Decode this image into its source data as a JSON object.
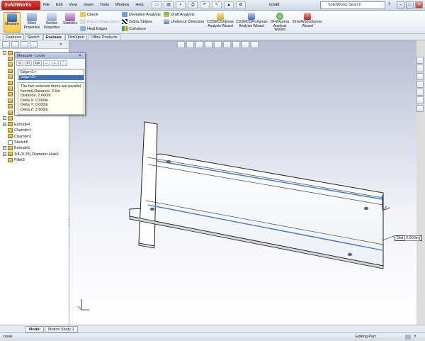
{
  "app": {
    "name": "SolidWorks",
    "doc_title": "cover",
    "search_placeholder": "SolidWorks Search"
  },
  "menu": [
    "File",
    "Edit",
    "View",
    "Insert",
    "Tools",
    "Window",
    "Help"
  ],
  "ribbon": {
    "big_buttons": [
      {
        "label1": "Measure",
        "label2": ""
      },
      {
        "label1": "Mass",
        "label2": "Properties"
      },
      {
        "label1": "Section",
        "label2": "Properties"
      },
      {
        "label1": "Statistics",
        "label2": ""
      }
    ],
    "col1": [
      {
        "label": "Check",
        "enabled": true
      },
      {
        "label": "Import Diagnostics",
        "enabled": false
      },
      {
        "label": "Heal Edges",
        "enabled": true
      }
    ],
    "col2": [
      {
        "label": "Deviation Analysis"
      },
      {
        "label": "Zebra Stripes"
      },
      {
        "label": "Curvature"
      }
    ],
    "col3": [
      {
        "label": "Draft Analysis"
      },
      {
        "label": "Undercut Detection"
      }
    ],
    "xpress": [
      {
        "label1": "COSMOSXpress",
        "label2": "Analysis Wizard"
      },
      {
        "label1": "COSMOSFloXpress",
        "label2": "Analysis Wizard"
      },
      {
        "label1": "DFMXpress",
        "label2": "Analysis",
        "label3": "Wizard"
      },
      {
        "label1": "DriveWorksXpress",
        "label2": "Wizard"
      }
    ]
  },
  "tabs": [
    "Features",
    "Sketch",
    "Evaluate",
    "DimXpert",
    "Office Products"
  ],
  "active_tab": "Evaluate",
  "measure_dialog": {
    "title": "Measure - cover",
    "tool_labels": [
      "in",
      "xyz"
    ],
    "selections": [
      "Edge<1>",
      "Edge<2>"
    ],
    "results": [
      "The two selected items are parallel.",
      "Normal Distance: 2.6in",
      "Distance: 2.600in",
      "Delta X: 0.000in",
      "Delta Y: 0.000in",
      "Delta Z: 2.600in"
    ]
  },
  "tree": [
    {
      "label": "cov",
      "expander": "-",
      "type": "root"
    },
    {
      "label": "",
      "expander": "",
      "type": "feat"
    },
    {
      "label": "",
      "expander": "",
      "type": "feat"
    },
    {
      "label": "",
      "expander": "",
      "type": "feat"
    },
    {
      "label": "",
      "expander": "",
      "type": "feat"
    },
    {
      "label": "",
      "expander": "",
      "type": "feat"
    },
    {
      "label": "",
      "expander": "",
      "type": "feat"
    },
    {
      "label": "",
      "expander": "",
      "type": "feat"
    },
    {
      "label": "",
      "expander": "",
      "type": "feat"
    },
    {
      "label": "",
      "expander": "",
      "type": "feat"
    },
    {
      "label": "",
      "expander": "",
      "type": "feat"
    },
    {
      "label": "",
      "expander": "+",
      "type": "feat"
    },
    {
      "label": "Extrude4",
      "expander": "+",
      "type": "feat"
    },
    {
      "label": "Chamfer1",
      "expander": "",
      "type": "feat"
    },
    {
      "label": "Chamfer2",
      "expander": "",
      "type": "feat"
    },
    {
      "label": "Sketch5",
      "expander": "",
      "type": "sketch"
    },
    {
      "label": "Extrude5",
      "expander": "+",
      "type": "feat"
    },
    {
      "label": "1/4 (0.25) Diameter Hole1",
      "expander": "+",
      "type": "feat"
    },
    {
      "label": "Fillet3",
      "expander": "",
      "type": "feat"
    }
  ],
  "dimension_tag": {
    "label": "Dist",
    "value": "2.600in"
  },
  "model_tabs": [
    "Model",
    "Motion Study 1"
  ],
  "status": {
    "left": "cover",
    "right": "Editing Part"
  },
  "colors": {
    "edge_highlight": "#3a78d8",
    "accent": "#f7c94a",
    "viewport_top": "#b8bdd4"
  }
}
